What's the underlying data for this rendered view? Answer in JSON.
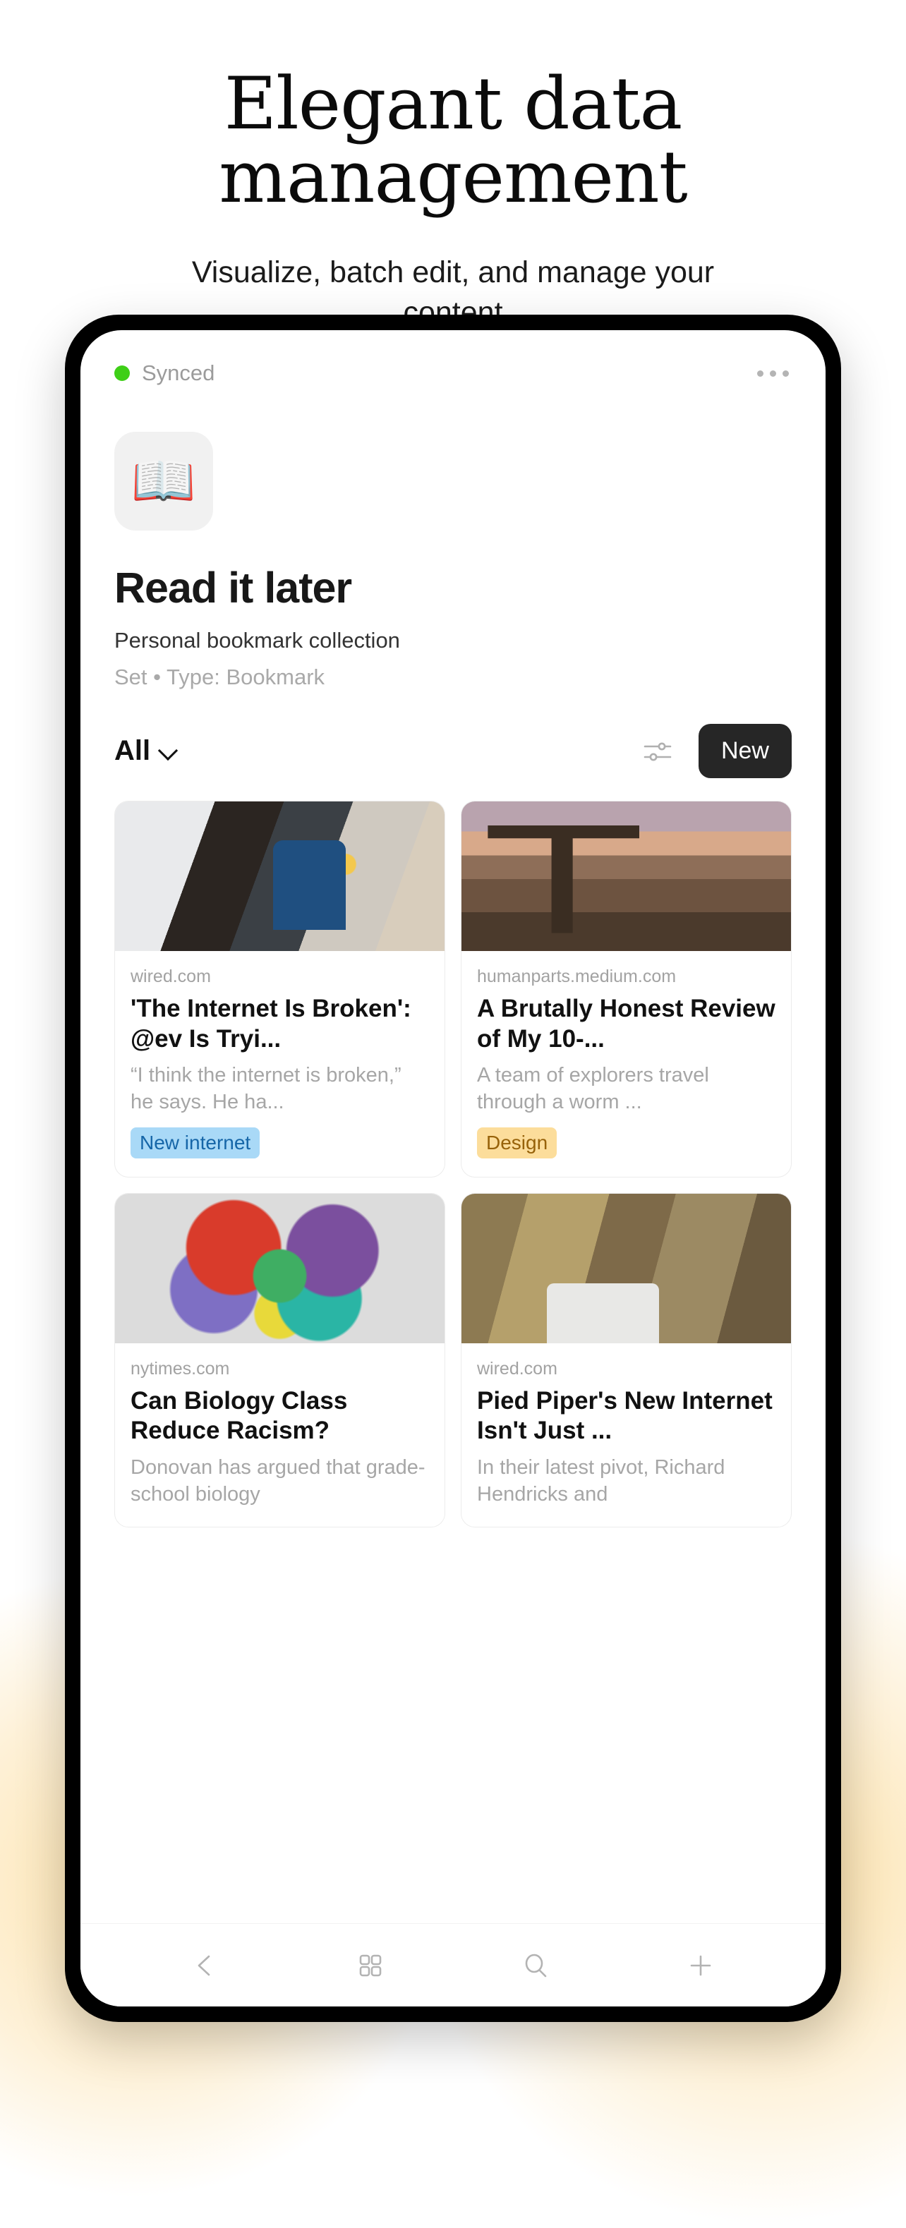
{
  "hero": {
    "headline": "Elegant data management",
    "subheadline": "Visualize, batch edit, and manage your content"
  },
  "phone": {
    "statusbar": {
      "sync_label": "Synced",
      "sync_color": "#3ecf17",
      "menu_icon": "ellipsis-icon"
    },
    "header": {
      "app_icon": "open-book-icon",
      "app_icon_glyph": "📖",
      "title": "Read it later",
      "subtitle": "Personal bookmark collection",
      "meta": "Set  •  Type: Bookmark"
    },
    "toolbar": {
      "filter_label": "All",
      "filter_chevron_icon": "chevron-down-icon",
      "sliders_icon": "sliders-icon",
      "new_label": "New"
    },
    "cards": [
      {
        "image": "office-man-photo",
        "source": "wired.com",
        "title": "'The Internet Is Broken': @ev Is Tryi...",
        "excerpt": "“I think the internet is broken,” he says. He ha...",
        "tag": "New internet",
        "tag_style": "blue",
        "tag_bg": "#a9d9f7",
        "tag_fg": "#1666a8"
      },
      {
        "image": "misty-field-sunrise-photo",
        "source": "humanparts.medium.com",
        "title": "A Brutally Honest Review of My 10-...",
        "excerpt": "A team of explorers travel through a worm ...",
        "tag": "Design",
        "tag_style": "amber",
        "tag_bg": "#fcdd9b",
        "tag_fg": "#97620a"
      },
      {
        "image": "colorful-abstract-burst-photo",
        "source": "nytimes.com",
        "title": "Can Biology Class Reduce Racism?",
        "excerpt": "Donovan has argued that grade-school biology",
        "tag": "",
        "tag_style": "",
        "tag_bg": "",
        "tag_fg": ""
      },
      {
        "image": "group-around-computer-photo",
        "source": "wired.com",
        "title": "Pied Piper's New Internet Isn't Just ...",
        "excerpt": "In their latest pivot, Richard Hendricks and",
        "tag": "",
        "tag_style": "",
        "tag_bg": "",
        "tag_fg": ""
      }
    ],
    "navbar": [
      {
        "icon": "back-chevron-icon",
        "label": "Back"
      },
      {
        "icon": "grid-icon",
        "label": "Grid"
      },
      {
        "icon": "search-icon",
        "label": "Search"
      },
      {
        "icon": "plus-icon",
        "label": "Add"
      }
    ]
  }
}
